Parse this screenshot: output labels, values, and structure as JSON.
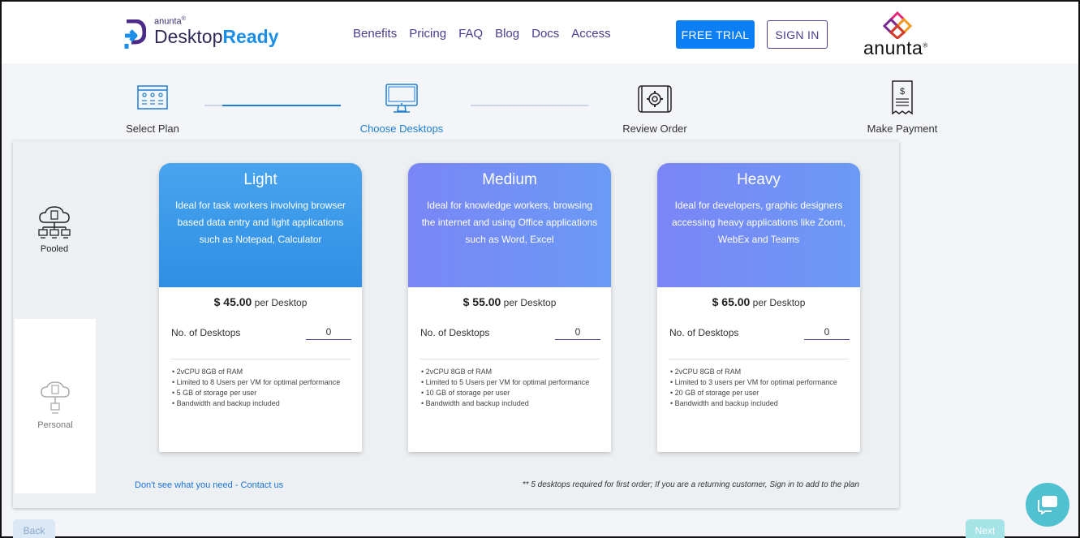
{
  "header": {
    "logo_small": "anunta",
    "logo_reg": "®",
    "logo_word1": "Desktop",
    "logo_word2": "Ready",
    "nav": [
      "Benefits",
      "Pricing",
      "FAQ",
      "Blog",
      "Docs",
      "Access"
    ],
    "free_trial": "FREE TRIAL",
    "sign_in": "SIGN IN",
    "brand": "anunta",
    "brand_reg": "®"
  },
  "steps": [
    {
      "label": "Select Plan",
      "icon": "browser-grid-icon",
      "state": "done"
    },
    {
      "label": "Choose Desktops",
      "icon": "monitor-icon",
      "state": "active"
    },
    {
      "label": "Review Order",
      "icon": "scroll-gear-icon",
      "state": "pending"
    },
    {
      "label": "Make Payment",
      "icon": "receipt-dollar-icon",
      "state": "pending"
    }
  ],
  "sidebar": {
    "pooled": "Pooled",
    "personal": "Personal"
  },
  "plans": [
    {
      "title": "Light",
      "desc": "Ideal for task workers involving browser based data entry and light applications such as Notepad, Calculator",
      "price": "$ 45.00",
      "per": "per Desktop",
      "qty_label": "No. of Desktops",
      "qty": "0",
      "features": [
        "2vCPU 8GB of RAM",
        "Limited to 8 Users per VM for optimal performance",
        "5 GB of storage per user",
        "Bandwidth and backup included"
      ]
    },
    {
      "title": "Medium",
      "desc": "Ideal for knowledge workers, browsing the internet and using Office applications such as Word, Excel",
      "price": "$ 55.00",
      "per": "per Desktop",
      "qty_label": "No. of Desktops",
      "qty": "0",
      "features": [
        "2vCPU 8GB of RAM",
        "Limited to 5 Users per VM for optimal performance",
        "10 GB of storage per user",
        "Bandwidth and backup included"
      ]
    },
    {
      "title": "Heavy",
      "desc": "Ideal for developers, graphic designers accessing heavy applications like Zoom, WebEx and Teams",
      "price": "$ 65.00",
      "per": "per Desktop",
      "qty_label": "No. of Desktops",
      "qty": "0",
      "features": [
        "2vCPU 8GB of RAM",
        "Limited to 3 users per VM for optimal performance",
        "20 GB of storage per user",
        "Bandwidth and backup included"
      ]
    }
  ],
  "footer": {
    "contact": "Don't see what you need - Contact us",
    "note": "** 5 desktops required for first order; If you are a returning customer, Sign in to add to the plan",
    "back": "Back",
    "next": "Next"
  },
  "colors": {
    "accent": "#0b7ff3",
    "nav": "#4b3d8f",
    "chat": "#4fc1d1"
  }
}
